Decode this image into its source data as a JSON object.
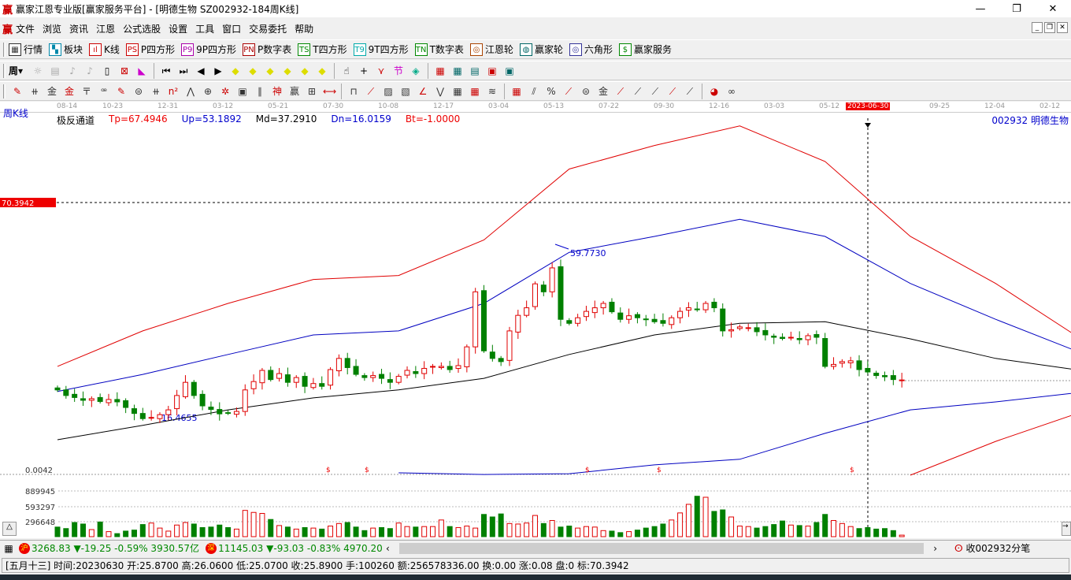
{
  "window": {
    "logo": "赢",
    "title": "赢家江恩专业版[赢家服务平台] - [明德生物   SZ002932-184周K线]",
    "min": "—",
    "max": "❐",
    "close": "✕"
  },
  "menu": [
    "文件",
    "浏览",
    "资讯",
    "江恩",
    "公式选股",
    "设置",
    "工具",
    "窗口",
    "交易委托",
    "帮助"
  ],
  "toolbar1": [
    {
      "icon": "table-icon",
      "g": "▦",
      "label": "行情"
    },
    {
      "icon": "blocks-icon",
      "g": "▚",
      "label": "板块"
    },
    {
      "icon": "kline-icon",
      "g": "ıl",
      "label": "K线"
    },
    {
      "icon": "ps-icon",
      "g": "PS",
      "label": "P四方形"
    },
    {
      "icon": "p9-icon",
      "g": "P9",
      "label": "9P四方形"
    },
    {
      "icon": "pn-icon",
      "g": "PN",
      "label": "P数字表"
    },
    {
      "icon": "ts-icon",
      "g": "TS",
      "label": "T四方形"
    },
    {
      "icon": "t9-icon",
      "g": "T9",
      "label": "9T四方形"
    },
    {
      "icon": "tn-icon",
      "g": "TN",
      "label": "T数字表"
    },
    {
      "icon": "wheel-icon",
      "g": "◎",
      "label": "江恩轮"
    },
    {
      "icon": "winner-wheel-icon",
      "g": "◍",
      "label": "赢家轮"
    },
    {
      "icon": "hexagon-icon",
      "g": "◎",
      "label": "六角形"
    },
    {
      "icon": "dollar-icon",
      "g": "$",
      "label": "赢家服务"
    }
  ],
  "toolbar2_period": "周",
  "axis_dates": [
    "08-14",
    "10-23",
    "12-31",
    "03-12",
    "05-21",
    "07-30",
    "10-08",
    "12-17",
    "03-04",
    "05-13",
    "07-22",
    "09-30",
    "12-16",
    "03-03",
    "05-12",
    "2023-06-30",
    "09-25",
    "12-04",
    "02-12"
  ],
  "chart": {
    "period": "周K线",
    "indicator": {
      "name": "极反通道",
      "tp": "Tp=67.4946",
      "up": "Up=53.1892",
      "md": "Md=37.2910",
      "dn": "Dn=16.0159",
      "bt": "Bt=-1.0000"
    },
    "stock": "002932  明德生物",
    "cursor_price": "70.3942",
    "high_label": "59.7730",
    "low_label": "16.4655",
    "vol_zero": "0.0042",
    "vol_ticks": [
      "889945",
      "593297",
      "296648"
    ],
    "colors": {
      "up": "#e00000",
      "down": "#008000",
      "upper": "#e00000",
      "band": "#0000c0",
      "mid": "#000000"
    }
  },
  "chart_data": {
    "type": "candlestick",
    "closes": [
      23.4,
      22,
      21.5,
      20.8,
      21.2,
      20.5,
      21,
      20.4,
      19,
      17.5,
      16.2,
      16.5,
      17.2,
      18.4,
      22,
      25.3,
      22,
      19.4,
      18.5,
      17.4,
      17.6,
      18,
      23.4,
      25.5,
      28.3,
      26,
      27.5,
      25.3,
      26.5,
      24.3,
      25,
      24.3,
      28.5,
      31.3,
      29,
      27.3,
      26.5,
      27,
      26.3,
      25.3,
      26.8,
      28.3,
      27.5,
      28.8,
      29.3,
      29.3,
      28.5,
      29.5,
      34.2,
      48,
      33.2,
      31.3,
      30.5,
      38.2,
      42.1,
      44,
      50,
      48,
      54,
      41.1,
      40.1,
      41.5,
      43.1,
      44,
      45.1,
      43,
      41.1,
      42,
      41.5,
      41.1,
      40.5,
      40.1,
      41.5,
      43.1,
      44,
      43.5,
      45.1,
      44,
      38.2,
      38.5,
      39.2,
      39,
      38,
      37.2,
      36.6,
      36.3,
      36.6,
      36,
      37,
      36.6,
      29.3,
      29.8,
      30.5,
      30.7,
      28.5,
      27.9,
      27,
      26.7,
      26,
      25.9
    ],
    "volumes": [
      190,
      160,
      280,
      250,
      140,
      290,
      100,
      60,
      110,
      130,
      240,
      270,
      170,
      110,
      230,
      280,
      250,
      180,
      190,
      230,
      180,
      150,
      520,
      480,
      460,
      340,
      220,
      190,
      150,
      180,
      170,
      150,
      210,
      260,
      280,
      190,
      120,
      170,
      180,
      160,
      270,
      200,
      190,
      200,
      200,
      330,
      200,
      180,
      210,
      170,
      440,
      390,
      450,
      260,
      250,
      270,
      420,
      260,
      320,
      190,
      210,
      170,
      200,
      190,
      120,
      110,
      80,
      100,
      130,
      170,
      200,
      250,
      330,
      470,
      640,
      800,
      780,
      500,
      530,
      390,
      210,
      200,
      170,
      200,
      240,
      310,
      230,
      220,
      210,
      280,
      440,
      320,
      260,
      200,
      160,
      180,
      150,
      160,
      120,
      30
    ],
    "channel_step": 10,
    "upper": [
      29.3,
      38.2,
      45.1,
      51.1,
      52.1,
      61,
      78.8,
      84.7,
      89.6,
      80.7,
      61.9,
      50.1,
      36.2
    ],
    "band_up": [
      23,
      27.3,
      32.3,
      37.2,
      38.2,
      45.1,
      57.9,
      61.9,
      66.2,
      61.9,
      50.1,
      41.1,
      32.7
    ],
    "mid": [
      10.9,
      14.5,
      18.4,
      21.4,
      23.4,
      26.3,
      32.3,
      37.2,
      40.1,
      40.5,
      36.2,
      31.3,
      28.3
    ],
    "band_dn": [
      null,
      null,
      null,
      null,
      2.6,
      2.2,
      2.4,
      4.6,
      6,
      12.5,
      18.4,
      20.4,
      22.8
    ],
    "lower": [
      null,
      null,
      null,
      null,
      null,
      null,
      null,
      null,
      null,
      null,
      2,
      10.5,
      17.8
    ]
  },
  "bottom": {
    "sh_badge": "沪",
    "sh": "3268.83 ▼-19.25 -0.59% 3930.57亿",
    "sz_badge": "深",
    "sz": "11145.03 ▼-93.03 -0.83% 4970.20",
    "tick": "收002932分笔",
    "left": "‹",
    "right": "›"
  },
  "status": "[五月十三] 时间:20230630 开:25.8700 高:26.0600 低:25.0700 收:25.8900 手:100260 额:256578336.00 换:0.00 涨:0.08 盘:0 标:70.3942"
}
